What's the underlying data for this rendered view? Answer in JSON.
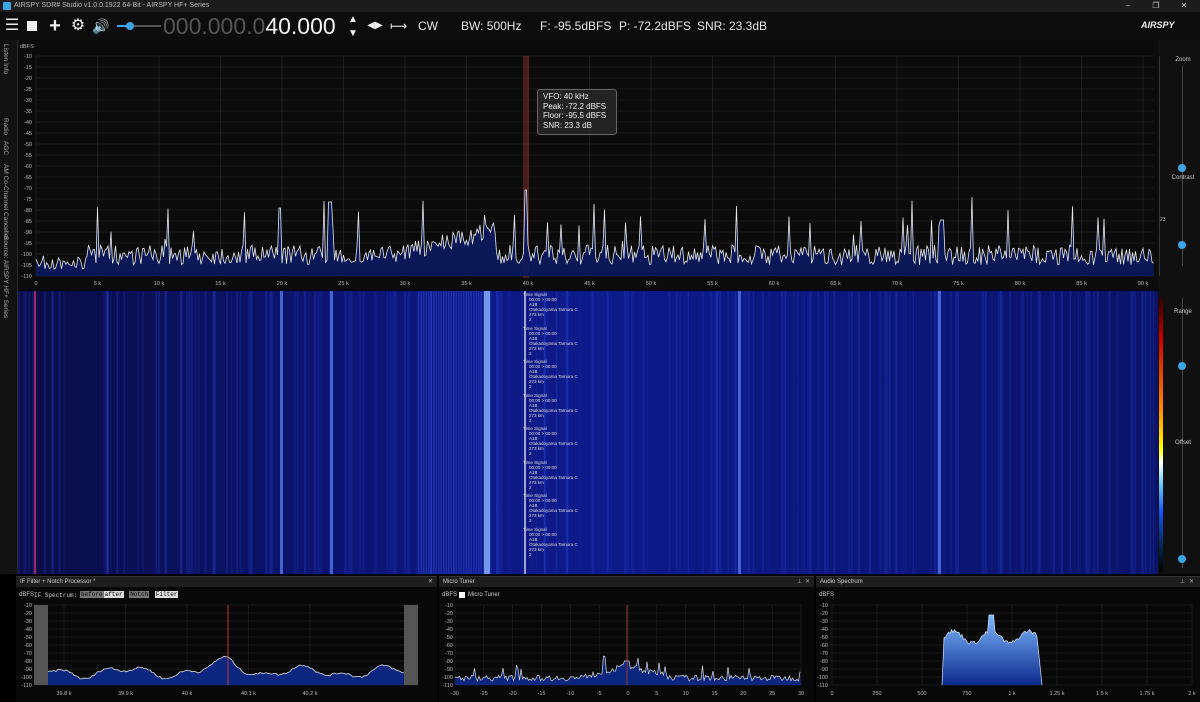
{
  "window": {
    "title": "AIRSPY SDR# Studio v1.0.0.1922 64-Bit - AIRSPY HF+ Series",
    "min": "–",
    "restore": "❐",
    "close": "✕"
  },
  "toolbar": {
    "menu_icon": "menu-icon",
    "stop_icon": "stop-icon",
    "add_icon": "plus-icon",
    "settings_icon": "gear-icon",
    "audio_icon": "speaker-icon",
    "frequency_dim": "000.000.0",
    "frequency_main": "40.000",
    "mode": "CW",
    "bw": "BW: 500Hz",
    "floor": "F: -95.5dBFS",
    "peak": "P: -72.2dBFS",
    "snr": "SNR: 23.3dB",
    "volume_level": 0.3,
    "logo": "AIRSPY"
  },
  "left_tabs": [
    "Listen Info",
    "Radio",
    "AGC",
    "AM Co-Channel Canceller",
    "Source: AIRSPY HF+ Series"
  ],
  "right_controls": {
    "zoom": "Zoom",
    "contrast": "Contrast",
    "range": "Range",
    "offset": "Offset",
    "level_badge": "23"
  },
  "spectrum": {
    "unit": "dBFS",
    "y_ticks": [
      "-10",
      "-15",
      "-20",
      "-25",
      "-30",
      "-35",
      "-40",
      "-45",
      "-50",
      "-55",
      "-60",
      "-65",
      "-70",
      "-75",
      "-80",
      "-85",
      "-90",
      "-95",
      "-100",
      "-105",
      "-110"
    ],
    "x_ticks": [
      "0",
      "5 k",
      "10 k",
      "15 k",
      "20 k",
      "25 k",
      "30 k",
      "35 k",
      "40 k",
      "45 k",
      "50 k",
      "55 k",
      "60 k",
      "65 k",
      "70 k",
      "75 k",
      "80 k",
      "85 k",
      "90 k"
    ],
    "tooltip": {
      "vfo": "VFO:  40 kHz",
      "peak": "Peak: -72.2 dBFS",
      "floor": "Floor: -95.5 dBFS",
      "snr": "SNR:  23.3 dB"
    }
  },
  "waterfall": {
    "annotation": {
      "title": "Time Signal",
      "time": "00:00 > 00:00",
      "code": "A1B",
      "station": "Otakadoyama Tamura C",
      "distance": "273 km",
      "extra": "2"
    }
  },
  "panels": {
    "if_filter": {
      "title": "IF Filter + Notch Processor *",
      "unit": "dBFS",
      "spectrum_label": "IF Spectrum:",
      "buttons": [
        "before",
        "after",
        "Notch",
        "Filter"
      ],
      "y_ticks": [
        "-10",
        "-20",
        "-30",
        "-40",
        "-50",
        "-60",
        "-70",
        "-80",
        "-90",
        "-100",
        "-110"
      ],
      "x_ticks": [
        "39.8 k",
        "39.9 k",
        "40 k",
        "40.1 k",
        "40.2 k"
      ]
    },
    "micro_tuner": {
      "title": "Micro Tuner",
      "unit": "dBFS",
      "checkbox_label": "Micro Tuner",
      "y_ticks": [
        "-10",
        "-20",
        "-30",
        "-40",
        "-50",
        "-60",
        "-70",
        "-80",
        "-90",
        "-100",
        "-110"
      ],
      "x_ticks": [
        "-30",
        "-25",
        "-20",
        "-15",
        "-10",
        "-5",
        "0",
        "5",
        "10",
        "15",
        "20",
        "25",
        "30"
      ]
    },
    "audio_spectrum": {
      "title": "Audio Spectrum",
      "unit": "dBFS",
      "y_ticks": [
        "-10",
        "-20",
        "-30",
        "-40",
        "-50",
        "-60",
        "-70",
        "-80",
        "-90",
        "-100",
        "-110"
      ],
      "x_ticks": [
        "0",
        "250",
        "500",
        "750",
        "1 k",
        "1.25 k",
        "1.5 k",
        "1.75 k",
        "2 k"
      ]
    },
    "pin_icon": "pin-icon",
    "close_icon": "close-icon"
  },
  "colors": {
    "accent": "#3aa5e8",
    "marker": "#c0392b",
    "spectrum_fill": "#0a1a60",
    "waterfall_bg": "#0a1270"
  }
}
